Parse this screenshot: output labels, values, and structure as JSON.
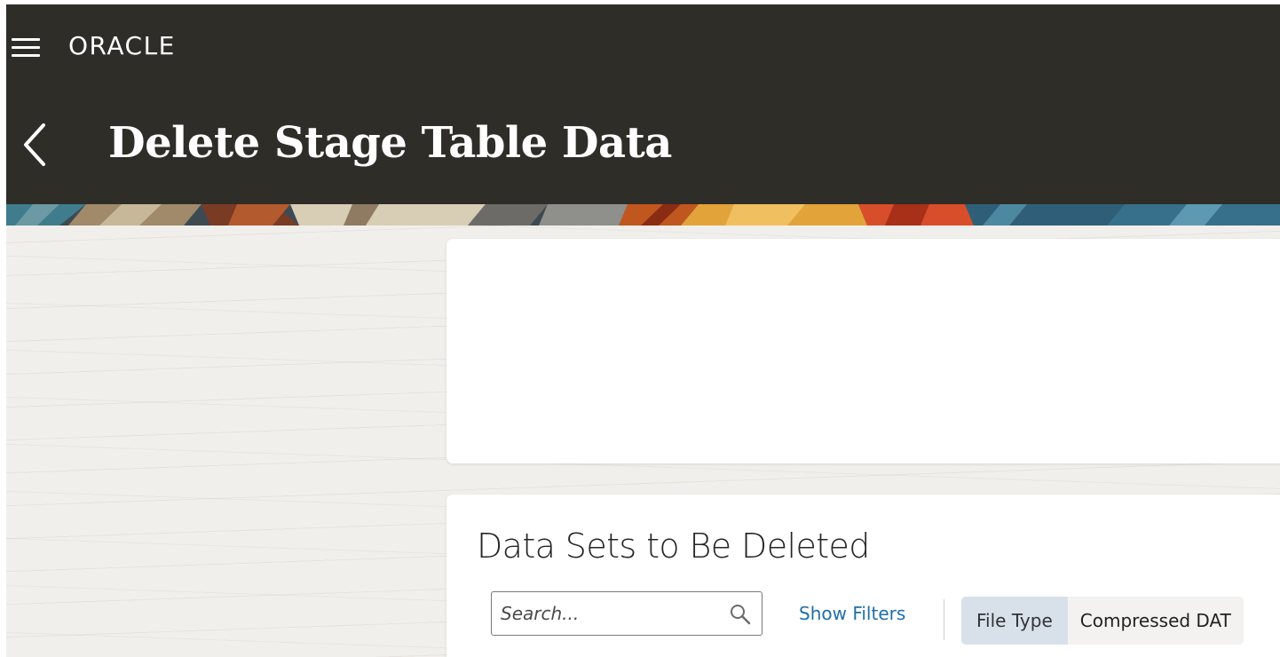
{
  "header": {
    "brand": "ORACLE",
    "menu_icon": "hamburger-menu-icon",
    "back_icon": "chevron-left-icon",
    "title": "Delete Stage Table Data"
  },
  "colors": {
    "header_bg": "#2e2d28",
    "page_bg": "#f1efec",
    "link": "#1e6fa8",
    "chip_label_bg": "#d8e1ea"
  },
  "section": {
    "title": "Data Sets to Be Deleted"
  },
  "search": {
    "placeholder": "Search...",
    "value": "",
    "icon": "search-icon"
  },
  "filters": {
    "show_filters_label": "Show Filters",
    "chip": {
      "label": "File Type",
      "value": "Compressed DAT"
    }
  }
}
